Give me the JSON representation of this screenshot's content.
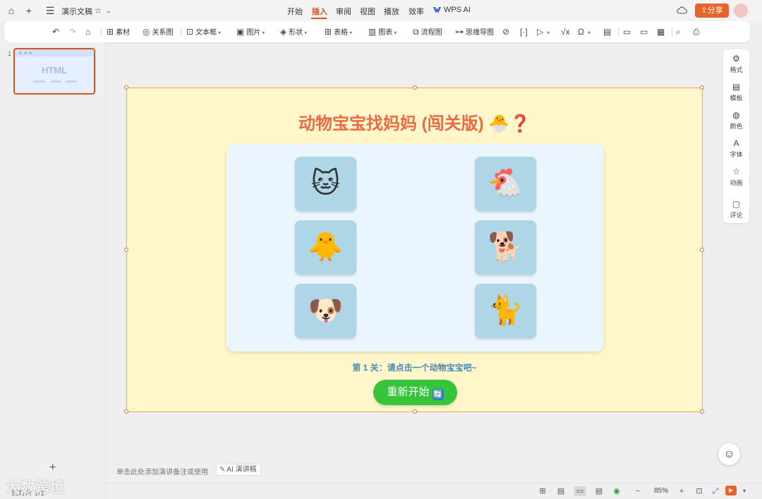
{
  "topbar": {
    "doc_title": "演示文稿",
    "tabs": [
      "开始",
      "插入",
      "审阅",
      "视图",
      "播放",
      "效率",
      "WPS AI"
    ],
    "active_tab": "插入",
    "share_label": "分享"
  },
  "toolbar": {
    "items": [
      "素材",
      "关系图",
      "文本框",
      "图片",
      "形状",
      "表格",
      "图表",
      "流程图",
      "思维导图"
    ]
  },
  "slide_panel": {
    "slide_number": "1",
    "thumb_text": "HTML",
    "slide_counter": "幻灯片 1/1"
  },
  "slide": {
    "title": "动物宝宝找妈妈 (闯关版)",
    "title_emoji": "🐣❓",
    "animals": [
      {
        "emoji": "🐱",
        "name": "cat"
      },
      {
        "emoji": "🐔",
        "name": "chicken"
      },
      {
        "emoji": "🐥",
        "name": "chick"
      },
      {
        "emoji": "🐕",
        "name": "dog"
      },
      {
        "emoji": "🐶",
        "name": "puppy"
      },
      {
        "emoji": "🐈",
        "name": "cat-adult"
      }
    ],
    "level_text": "第 1 关：请点击一个动物宝宝吧~",
    "restart_label": "重新开始",
    "restart_icon": "🔄"
  },
  "right_panel": {
    "items": [
      "格式",
      "模板",
      "颜色",
      "字体",
      "动画",
      "评论"
    ]
  },
  "notes": {
    "placeholder": "单击此处添加演讲备注或使用",
    "ai_notes_label": "AI 演讲稿"
  },
  "watermark": "大数跨境",
  "status": {
    "zoom": "85%"
  },
  "colors": {
    "accent": "#d2561b",
    "share": "#e8632a",
    "slide_bg": "#fff7c9",
    "title": "#ea6a45",
    "card_bg": "#ebf5fd",
    "tile_bg": "#aed6e6",
    "level_text": "#4a89b8",
    "restart_bg": "#36c43b"
  }
}
